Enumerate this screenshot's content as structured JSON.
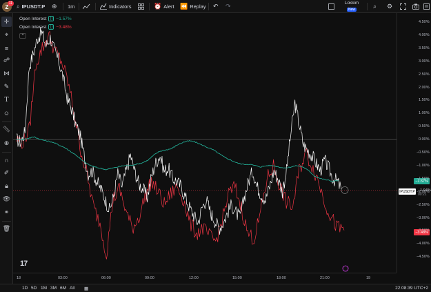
{
  "header": {
    "avatar_letter": "Z",
    "notification_count": "11",
    "symbol": "IPUSDT.P",
    "interval": "1m",
    "indicators_label": "Indicators",
    "alert_label": "Alert",
    "replay_label": "Replay",
    "trade_name": "Lokkim",
    "trade_status": "New"
  },
  "legend": [
    {
      "name": "Open Interest",
      "value": "−1.57%",
      "color": "#22ab94"
    },
    {
      "name": "Open Interest",
      "value": "−3.48%",
      "color": "#f23645"
    }
  ],
  "price_axis": {
    "ticks": [
      "4.50%",
      "4.00%",
      "3.50%",
      "3.00%",
      "2.50%",
      "2.00%",
      "1.50%",
      "1.00%",
      "0.50%",
      "0.00%",
      "−0.50%",
      "−1.00%",
      "−1.50%",
      "−2.00%",
      "−2.50%",
      "−3.00%",
      "−3.50%",
      "−4.00%",
      "−4.50%"
    ],
    "badges": {
      "green": "−1.57%",
      "red": "−3.48%",
      "symbol": "IPUSDT.P",
      "symbol_value": "−1.94%",
      "countdown": "00:21"
    }
  },
  "time_axis": {
    "ticks": [
      "18",
      "03:00",
      "06:00",
      "09:00",
      "12:00",
      "15:00",
      "18:00",
      "21:00",
      "19"
    ]
  },
  "bottom": {
    "ranges": [
      "1D",
      "5D",
      "1M",
      "3M",
      "6M",
      "All"
    ],
    "clock": "22:08:39 UTC+2"
  },
  "chart_data": {
    "type": "line",
    "ylim": [
      -4.6,
      4.6
    ],
    "y_unit": "%",
    "x_ticks": [
      "18",
      "03:00",
      "06:00",
      "09:00",
      "12:00",
      "15:00",
      "18:00",
      "21:00",
      "19"
    ],
    "series": [
      {
        "name": "IPUSDT.P",
        "color": "#ffffff",
        "values": [
          0.0,
          -0.1,
          0.3,
          2.8,
          3.3,
          3.9,
          4.1,
          3.6,
          3.9,
          3.4,
          3.0,
          2.4,
          1.6,
          1.2,
          0.6,
          0.2,
          -0.6,
          -1.3,
          -1.2,
          -1.6,
          -1.9,
          -2.3,
          -2.7,
          -2.2,
          -1.3,
          -1.8,
          -1.2,
          -0.6,
          -1.2,
          -1.7,
          -1.9,
          -2.2,
          -1.4,
          -0.9,
          -0.6,
          -1.2,
          -1.1,
          -1.5,
          -1.6,
          -1.8,
          -2.2,
          -2.6,
          -2.9,
          -3.2,
          -2.6,
          -2.3,
          -2.8,
          -3.1,
          -3.4,
          -3.2,
          -2.8,
          -2.5,
          -2.8,
          -3.0,
          -2.2,
          -1.6,
          -1.2,
          -1.8,
          -2.1,
          -2.3,
          -1.8,
          -1.2,
          -1.5,
          -2.0,
          -1.2,
          0.2,
          1.4,
          0.6,
          -0.2,
          -0.4,
          -0.6,
          -0.9,
          -1.2,
          -0.8,
          -1.1,
          -1.5,
          -1.6,
          -1.9
        ]
      },
      {
        "name": "Open Interest",
        "color": "#22ab94",
        "values": [
          0.0,
          0.0,
          0.05,
          0.1,
          0.0,
          -0.05,
          -0.1,
          -0.2,
          -0.3,
          -0.45,
          -0.6,
          -0.8,
          -0.95,
          -1.05,
          -1.1,
          -1.15,
          -1.1,
          -1.05,
          -1.0,
          -1.0,
          -0.95,
          -0.9,
          -0.8,
          -0.6,
          -0.45,
          -0.4,
          -0.35,
          -0.2,
          -0.1,
          -0.05,
          -0.1,
          -0.2,
          -0.3,
          -0.4,
          -0.55,
          -0.7,
          -0.8,
          -0.9,
          -0.95,
          -0.95,
          -1.0,
          -1.05,
          -1.0,
          -1.0,
          -1.05,
          -1.1,
          -1.05,
          -1.0,
          -1.05,
          -1.2,
          -1.4,
          -1.5,
          -1.55,
          -1.6,
          -1.57
        ]
      },
      {
        "name": "Open Interest",
        "color": "#f23645",
        "values": [
          0.0,
          -0.1,
          0.4,
          2.9,
          3.5,
          4.0,
          3.4,
          3.0,
          2.2,
          1.0,
          -0.4,
          -1.4,
          -2.6,
          -3.2,
          -4.4,
          -2.3,
          -1.9,
          -2.7,
          -3.4,
          -3.0,
          -2.2,
          -1.6,
          -2.0,
          -2.5,
          -2.1,
          -1.8,
          -2.3,
          -3.2,
          -3.6,
          -3.4,
          -3.7,
          -3.9,
          -3.1,
          -2.1,
          -1.8,
          -2.6,
          -3.6,
          -3.8,
          -2.8,
          -1.5,
          -1.0,
          -1.8,
          -2.4,
          -2.6,
          -1.2,
          -0.5,
          -1.0,
          -1.6,
          -2.4,
          -3.0,
          -3.4,
          -3.48
        ]
      }
    ]
  }
}
